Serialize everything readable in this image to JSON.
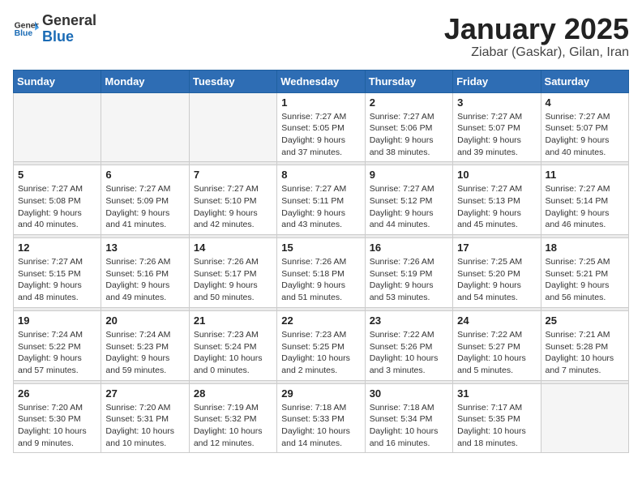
{
  "header": {
    "logo_general": "General",
    "logo_blue": "Blue",
    "title": "January 2025",
    "location": "Ziabar (Gaskar), Gilan, Iran"
  },
  "days_of_week": [
    "Sunday",
    "Monday",
    "Tuesday",
    "Wednesday",
    "Thursday",
    "Friday",
    "Saturday"
  ],
  "weeks": [
    {
      "days": [
        {
          "num": "",
          "empty": true
        },
        {
          "num": "",
          "empty": true
        },
        {
          "num": "",
          "empty": true
        },
        {
          "num": "1",
          "sunrise": "7:27 AM",
          "sunset": "5:05 PM",
          "daylight": "9 hours and 37 minutes."
        },
        {
          "num": "2",
          "sunrise": "7:27 AM",
          "sunset": "5:06 PM",
          "daylight": "9 hours and 38 minutes."
        },
        {
          "num": "3",
          "sunrise": "7:27 AM",
          "sunset": "5:07 PM",
          "daylight": "9 hours and 39 minutes."
        },
        {
          "num": "4",
          "sunrise": "7:27 AM",
          "sunset": "5:07 PM",
          "daylight": "9 hours and 40 minutes."
        }
      ]
    },
    {
      "days": [
        {
          "num": "5",
          "sunrise": "7:27 AM",
          "sunset": "5:08 PM",
          "daylight": "9 hours and 40 minutes."
        },
        {
          "num": "6",
          "sunrise": "7:27 AM",
          "sunset": "5:09 PM",
          "daylight": "9 hours and 41 minutes."
        },
        {
          "num": "7",
          "sunrise": "7:27 AM",
          "sunset": "5:10 PM",
          "daylight": "9 hours and 42 minutes."
        },
        {
          "num": "8",
          "sunrise": "7:27 AM",
          "sunset": "5:11 PM",
          "daylight": "9 hours and 43 minutes."
        },
        {
          "num": "9",
          "sunrise": "7:27 AM",
          "sunset": "5:12 PM",
          "daylight": "9 hours and 44 minutes."
        },
        {
          "num": "10",
          "sunrise": "7:27 AM",
          "sunset": "5:13 PM",
          "daylight": "9 hours and 45 minutes."
        },
        {
          "num": "11",
          "sunrise": "7:27 AM",
          "sunset": "5:14 PM",
          "daylight": "9 hours and 46 minutes."
        }
      ]
    },
    {
      "days": [
        {
          "num": "12",
          "sunrise": "7:27 AM",
          "sunset": "5:15 PM",
          "daylight": "9 hours and 48 minutes."
        },
        {
          "num": "13",
          "sunrise": "7:26 AM",
          "sunset": "5:16 PM",
          "daylight": "9 hours and 49 minutes."
        },
        {
          "num": "14",
          "sunrise": "7:26 AM",
          "sunset": "5:17 PM",
          "daylight": "9 hours and 50 minutes."
        },
        {
          "num": "15",
          "sunrise": "7:26 AM",
          "sunset": "5:18 PM",
          "daylight": "9 hours and 51 minutes."
        },
        {
          "num": "16",
          "sunrise": "7:26 AM",
          "sunset": "5:19 PM",
          "daylight": "9 hours and 53 minutes."
        },
        {
          "num": "17",
          "sunrise": "7:25 AM",
          "sunset": "5:20 PM",
          "daylight": "9 hours and 54 minutes."
        },
        {
          "num": "18",
          "sunrise": "7:25 AM",
          "sunset": "5:21 PM",
          "daylight": "9 hours and 56 minutes."
        }
      ]
    },
    {
      "days": [
        {
          "num": "19",
          "sunrise": "7:24 AM",
          "sunset": "5:22 PM",
          "daylight": "9 hours and 57 minutes."
        },
        {
          "num": "20",
          "sunrise": "7:24 AM",
          "sunset": "5:23 PM",
          "daylight": "9 hours and 59 minutes."
        },
        {
          "num": "21",
          "sunrise": "7:23 AM",
          "sunset": "5:24 PM",
          "daylight": "10 hours and 0 minutes."
        },
        {
          "num": "22",
          "sunrise": "7:23 AM",
          "sunset": "5:25 PM",
          "daylight": "10 hours and 2 minutes."
        },
        {
          "num": "23",
          "sunrise": "7:22 AM",
          "sunset": "5:26 PM",
          "daylight": "10 hours and 3 minutes."
        },
        {
          "num": "24",
          "sunrise": "7:22 AM",
          "sunset": "5:27 PM",
          "daylight": "10 hours and 5 minutes."
        },
        {
          "num": "25",
          "sunrise": "7:21 AM",
          "sunset": "5:28 PM",
          "daylight": "10 hours and 7 minutes."
        }
      ]
    },
    {
      "days": [
        {
          "num": "26",
          "sunrise": "7:20 AM",
          "sunset": "5:30 PM",
          "daylight": "10 hours and 9 minutes."
        },
        {
          "num": "27",
          "sunrise": "7:20 AM",
          "sunset": "5:31 PM",
          "daylight": "10 hours and 10 minutes."
        },
        {
          "num": "28",
          "sunrise": "7:19 AM",
          "sunset": "5:32 PM",
          "daylight": "10 hours and 12 minutes."
        },
        {
          "num": "29",
          "sunrise": "7:18 AM",
          "sunset": "5:33 PM",
          "daylight": "10 hours and 14 minutes."
        },
        {
          "num": "30",
          "sunrise": "7:18 AM",
          "sunset": "5:34 PM",
          "daylight": "10 hours and 16 minutes."
        },
        {
          "num": "31",
          "sunrise": "7:17 AM",
          "sunset": "5:35 PM",
          "daylight": "10 hours and 18 minutes."
        },
        {
          "num": "",
          "empty": true
        }
      ]
    }
  ],
  "labels": {
    "sunrise": "Sunrise:",
    "sunset": "Sunset:",
    "daylight": "Daylight:"
  }
}
